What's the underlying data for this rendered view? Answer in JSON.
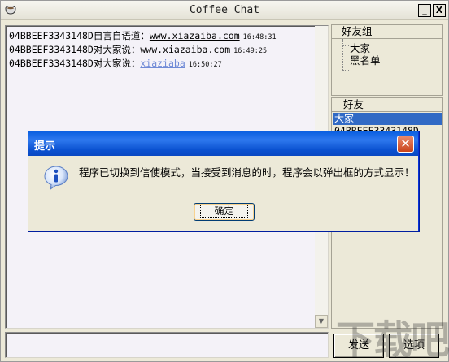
{
  "window": {
    "title": "Coffee Chat",
    "minimize_label": "_",
    "close_label": "X"
  },
  "chat": {
    "messages": [
      {
        "prefix": "04BBEEF3343148D自言自语道：",
        "link": "www.xiazaiba.com",
        "time": "16:48:31"
      },
      {
        "prefix": "04BBEEF3343148D对大家说：",
        "link": "www.xiazaiba.com",
        "time": "16:49:25"
      },
      {
        "prefix": "04BBEEF3343148D对大家说：",
        "link": "xiaziaba",
        "time": "16:50:27"
      }
    ]
  },
  "groups": {
    "header": "好友组",
    "items": [
      "大家",
      "黑名单"
    ]
  },
  "friends": {
    "header": "好友",
    "items": [
      "大家",
      "04BBEEF3343148D"
    ],
    "selected_index": 0
  },
  "buttons": {
    "send": "发送",
    "options": "选项"
  },
  "dialog": {
    "title": "提示",
    "close_label": "✕",
    "message": "程序已切换到信使模式，当接受到消息的时，程序会以弹出框的方式显示！",
    "ok_label": "确定"
  },
  "watermark": "下载吧",
  "colors": {
    "selection": "#316ac5",
    "dialog_title_bar": "#0a5fe0",
    "link_blue": "#6f8ad6"
  }
}
